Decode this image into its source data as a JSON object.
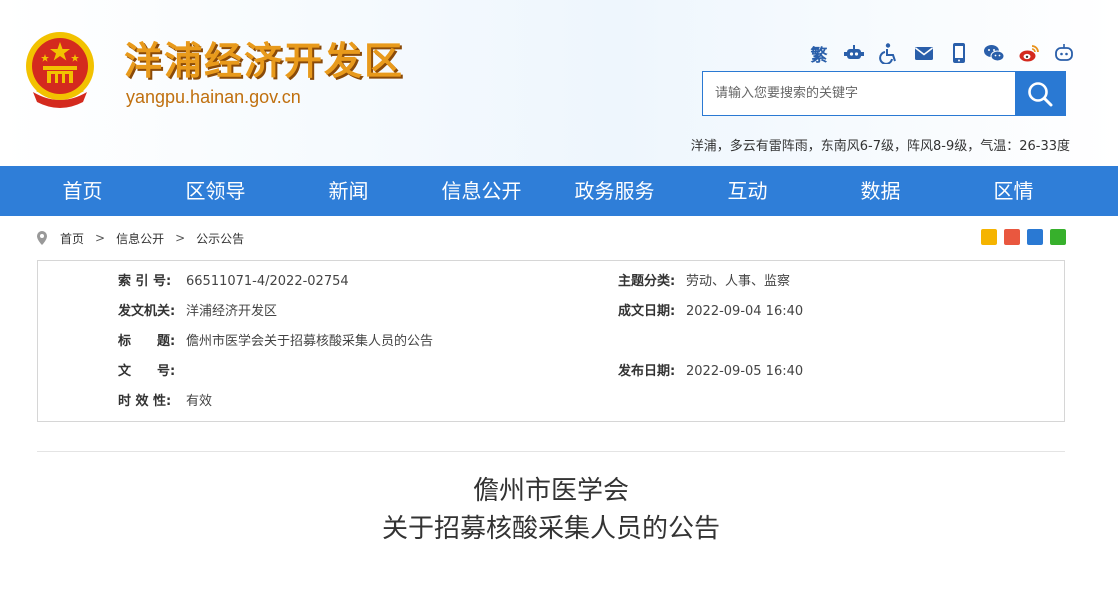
{
  "header": {
    "site_name": "洋浦经济开发区",
    "domain": "yangpu.hainan.gov.cn",
    "traditional_label": "繁",
    "tool_icons": [
      "robot-icon",
      "accessibility-icon",
      "mail-icon",
      "mobile-icon",
      "wechat-icon",
      "weibo-icon",
      "assistant-icon"
    ],
    "weather": "洋浦，多云有雷阵雨，东南风6-7级，阵风8-9级，气温：26-33度"
  },
  "search": {
    "placeholder": "请输入您要搜索的关键字"
  },
  "nav": {
    "items": [
      {
        "label": "首页"
      },
      {
        "label": "区领导"
      },
      {
        "label": "新闻"
      },
      {
        "label": "信息公开"
      },
      {
        "label": "政务服务"
      },
      {
        "label": "互动"
      },
      {
        "label": "数据"
      },
      {
        "label": "区情"
      }
    ]
  },
  "breadcrumb": [
    "首页",
    "信息公开",
    "公示公告"
  ],
  "share_icons": [
    "qzone-icon",
    "weibo-share-icon",
    "renren-icon",
    "wechat-share-icon"
  ],
  "meta": {
    "index_label": "索 引 号:",
    "index_value": "66511071-4/2022-02754",
    "topic_label": "主题分类:",
    "topic_value": "劳动、人事、监察",
    "issuer_label": "发文机关:",
    "issuer_value": "洋浦经济开发区",
    "created_label": "成文日期:",
    "created_value": "2022-09-04 16:40",
    "title_label": "标　　题:",
    "title_value": "儋州市医学会关于招募核酸采集人员的公告",
    "docno_label": "文　　号:",
    "docno_value": "",
    "published_label": "发布日期:",
    "published_value": "2022-09-05 16:40",
    "validity_label": "时 效 性:",
    "validity_value": "有效"
  },
  "article": {
    "title_line1": "儋州市医学会",
    "title_line2": "关于招募核酸采集人员的公告"
  },
  "colors": {
    "nav_blue": "#2f7ed8",
    "site_name_orange": "#e89a1c",
    "emblem_red": "#d42a1e",
    "emblem_gold": "#f2c200"
  }
}
